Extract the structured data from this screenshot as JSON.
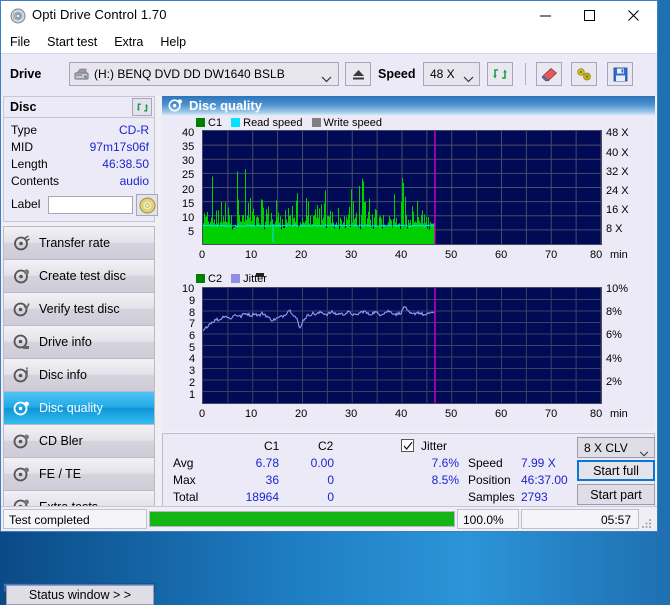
{
  "window": {
    "title": "Opti Drive Control 1.70",
    "icon": "disc-icon",
    "controls": {
      "minimize": "–",
      "maximize": "□",
      "close": "✕"
    }
  },
  "menu": {
    "items": [
      "File",
      "Start test",
      "Extra",
      "Help"
    ]
  },
  "toolbar": {
    "drive_label": "Drive",
    "drive_value": "(H:)   BENQ DVD DD DW1640 BSLB",
    "eject_icon": "eject-icon",
    "speed_label": "Speed",
    "speed_value": "48 X",
    "refresh_icon": "refresh-icon",
    "erase_icon": "eraser-icon",
    "tools_icon": "tools-icon",
    "save_icon": "floppy-save-icon"
  },
  "disc": {
    "header": "Disc",
    "refresh_icon": "refresh-icon",
    "rows": [
      {
        "key": "Type",
        "value": "CD-R"
      },
      {
        "key": "MID",
        "value": "97m17s06f"
      },
      {
        "key": "Length",
        "value": "46:38.50"
      },
      {
        "key": "Contents",
        "value": "audio"
      }
    ],
    "label_key": "Label",
    "label_value": "",
    "label_placeholder": "",
    "disc_icon": "cd-disc-icon"
  },
  "sidebar": {
    "items": [
      {
        "label": "Transfer rate",
        "icon": "disc-speed-icon",
        "selected": false
      },
      {
        "label": "Create test disc",
        "icon": "disc-write-icon",
        "selected": false
      },
      {
        "label": "Verify test disc",
        "icon": "disc-verify-icon",
        "selected": false
      },
      {
        "label": "Drive info",
        "icon": "disc-drive-icon",
        "selected": false
      },
      {
        "label": "Disc info",
        "icon": "disc-info-icon",
        "selected": false
      },
      {
        "label": "Disc quality",
        "icon": "disc-quality-icon",
        "selected": true
      },
      {
        "label": "CD Bler",
        "icon": "disc-bler-icon",
        "selected": false
      },
      {
        "label": "FE / TE",
        "icon": "disc-fete-icon",
        "selected": false
      },
      {
        "label": "Extra tests",
        "icon": "disc-extra-icon",
        "selected": false
      }
    ],
    "status_window_button": "Status window > >"
  },
  "main": {
    "section_title": "Disc quality",
    "section_icon": "disc-quality-icon"
  },
  "chart_data": [
    {
      "type": "line",
      "name": "c1-chart",
      "title": "",
      "xlabel": "min",
      "ylabel": "",
      "xlim": [
        0,
        80
      ],
      "ylim": [
        0,
        40
      ],
      "y2lim": [
        0,
        48
      ],
      "xticks": [
        0,
        10,
        20,
        30,
        40,
        50,
        60,
        70,
        80
      ],
      "yticks": [
        5,
        10,
        15,
        20,
        25,
        30,
        35,
        40
      ],
      "y2ticks": [
        "8 X",
        "16 X",
        "24 X",
        "32 X",
        "40 X",
        "48 X"
      ],
      "grid": true,
      "legend": [
        {
          "label": "C1",
          "color": "#008000"
        },
        {
          "label": "Read speed",
          "color": "#00e5ff"
        },
        {
          "label": "Write speed",
          "color": "#808080"
        }
      ],
      "data_end_x": 46.62,
      "cursor_x": 46.62,
      "series": [
        {
          "name": "C1",
          "color": "#00d000",
          "values": [
            8,
            10,
            12,
            9,
            27,
            14,
            11,
            16,
            22,
            13,
            10,
            33,
            31,
            29,
            18,
            14,
            31,
            11,
            30,
            21,
            31,
            14,
            21,
            10,
            22,
            12,
            13,
            25,
            16,
            11,
            19,
            12,
            21,
            15,
            19,
            13,
            16,
            11,
            20,
            13,
            17,
            10,
            14,
            12,
            35,
            26,
            12,
            9,
            12,
            18,
            21,
            10,
            14,
            11,
            17,
            20,
            12,
            14,
            36,
            26,
            14,
            11,
            18,
            10,
            15,
            23,
            9,
            13,
            11,
            17,
            28,
            13,
            12,
            16,
            29,
            26,
            19,
            13,
            21,
            15,
            12,
            11,
            16,
            10,
            21,
            13,
            17,
            10,
            14,
            9,
            20,
            12,
            15,
            11,
            36,
            19,
            13,
            16,
            22,
            11,
            14,
            18,
            9,
            12,
            10,
            15,
            8,
            11,
            9,
            7
          ]
        },
        {
          "name": "Read speed",
          "color": "#00e5ff",
          "approx_constant_x": "6.6",
          "note": "flat cyan line near 6.5 units on left axis, dropout spike at ~14 min"
        }
      ]
    },
    {
      "type": "line",
      "name": "c2-jitter-chart",
      "title": "",
      "xlabel": "min",
      "ylabel": "",
      "xlim": [
        0,
        80
      ],
      "ylim": [
        0,
        10
      ],
      "y2lim": [
        0,
        10
      ],
      "xticks": [
        0,
        10,
        20,
        30,
        40,
        50,
        60,
        70,
        80
      ],
      "yticks": [
        1,
        2,
        3,
        4,
        5,
        6,
        7,
        8,
        9,
        10
      ],
      "y2ticks": [
        "2%",
        "4%",
        "6%",
        "8%",
        "10%"
      ],
      "grid": true,
      "legend": [
        {
          "label": "C2",
          "color": "#008000"
        },
        {
          "label": "Jitter",
          "color": "#8f8fe8"
        }
      ],
      "data_end_x": 46.62,
      "cursor_x": 46.62,
      "series": [
        {
          "name": "Jitter",
          "color": "#9a9aef",
          "values": [
            6.2,
            6.5,
            6.8,
            7.0,
            7.1,
            7.3,
            7.2,
            7.4,
            7.6,
            7.5,
            7.3,
            7.5,
            7.7,
            7.6,
            7.5,
            7.7,
            7.8,
            7.7,
            7.6,
            7.8,
            7.7,
            7.6,
            7.8,
            7.7,
            7.5,
            7.3,
            7.2,
            7.3,
            7.4,
            7.5,
            7.6,
            7.8,
            8.1,
            7.9,
            7.6,
            7.3,
            6.4,
            7.1,
            7.4,
            7.6,
            7.7,
            7.8,
            7.7,
            7.8,
            7.9,
            7.8,
            7.7,
            7.8,
            7.9,
            7.8,
            7.7,
            7.8,
            7.7,
            7.8,
            7.9,
            7.8,
            7.7,
            7.6,
            7.8,
            7.9,
            8.0,
            7.8,
            7.7,
            7.8,
            7.9,
            7.8,
            7.7,
            7.8,
            7.9,
            8.0,
            7.9,
            7.8,
            7.7,
            7.8,
            7.9,
            8.5,
            8.0,
            7.8,
            7.7,
            7.8,
            7.9,
            7.8,
            7.7,
            7.6,
            7.8,
            7.9,
            7.8
          ]
        },
        {
          "name": "C2",
          "color": "#008000",
          "values": []
        }
      ]
    }
  ],
  "stats": {
    "col_headers": [
      "C1",
      "C2"
    ],
    "row_labels": [
      "Avg",
      "Max",
      "Total"
    ],
    "c1": [
      "6.78",
      "36",
      "18964"
    ],
    "c2": [
      "0.00",
      "0",
      "0"
    ],
    "jitter_label": "Jitter",
    "jitter_checked": true,
    "jitter": [
      "7.6%",
      "8.5%"
    ],
    "speed_label": "Speed",
    "speed_value": "7.99 X",
    "position_label": "Position",
    "position_value": "46:37.00",
    "samples_label": "Samples",
    "samples_value": "2793",
    "speed_select_value": "8 X CLV",
    "start_full_label": "Start full",
    "start_part_label": "Start part"
  },
  "statusbar": {
    "message": "Test completed",
    "progress_text": "100.0%",
    "progress_percent": 100,
    "elapsed": "05:57"
  },
  "colors": {
    "accent_blue": "#0a78d0",
    "value_blue": "#1c24d2",
    "plot_bg": "#000a55",
    "c1_green": "#00d000",
    "read_speed_cyan": "#00e5ff",
    "jitter_purple": "#9a9aef",
    "cursor_magenta": "#d000d0",
    "progress_green": "#16b516"
  }
}
